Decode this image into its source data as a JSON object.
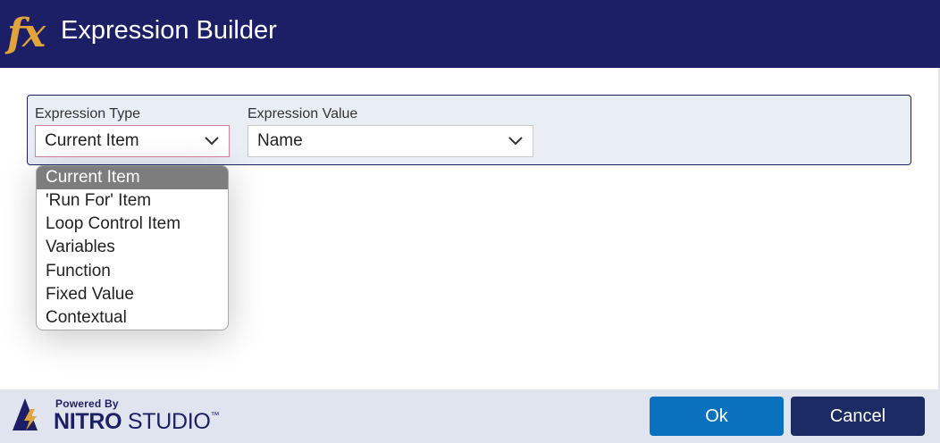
{
  "window": {
    "title": "Expression Builder",
    "icon_text": "fx"
  },
  "panel": {
    "expression_type": {
      "label": "Expression Type",
      "value": "Current Item"
    },
    "expression_value": {
      "label": "Expression Value",
      "value": "Name"
    }
  },
  "dropdown": {
    "options": [
      "Current Item",
      "'Run For' Item",
      "Loop Control Item",
      "Variables",
      "Function",
      "Fixed Value",
      "Contextual"
    ],
    "selected": "Current Item"
  },
  "footer": {
    "powered_by": "Powered By",
    "brand_bold": "NITRO",
    "brand_regular": " STUDIO",
    "trademark": "™",
    "ok_label": "Ok",
    "cancel_label": "Cancel"
  },
  "colors": {
    "titlebar": "#1c1f66",
    "icon_accent": "#e0a43a",
    "ok_button": "#0a71bf",
    "cancel_button": "#1c2b63",
    "selected_option": "#7d7d7d"
  }
}
